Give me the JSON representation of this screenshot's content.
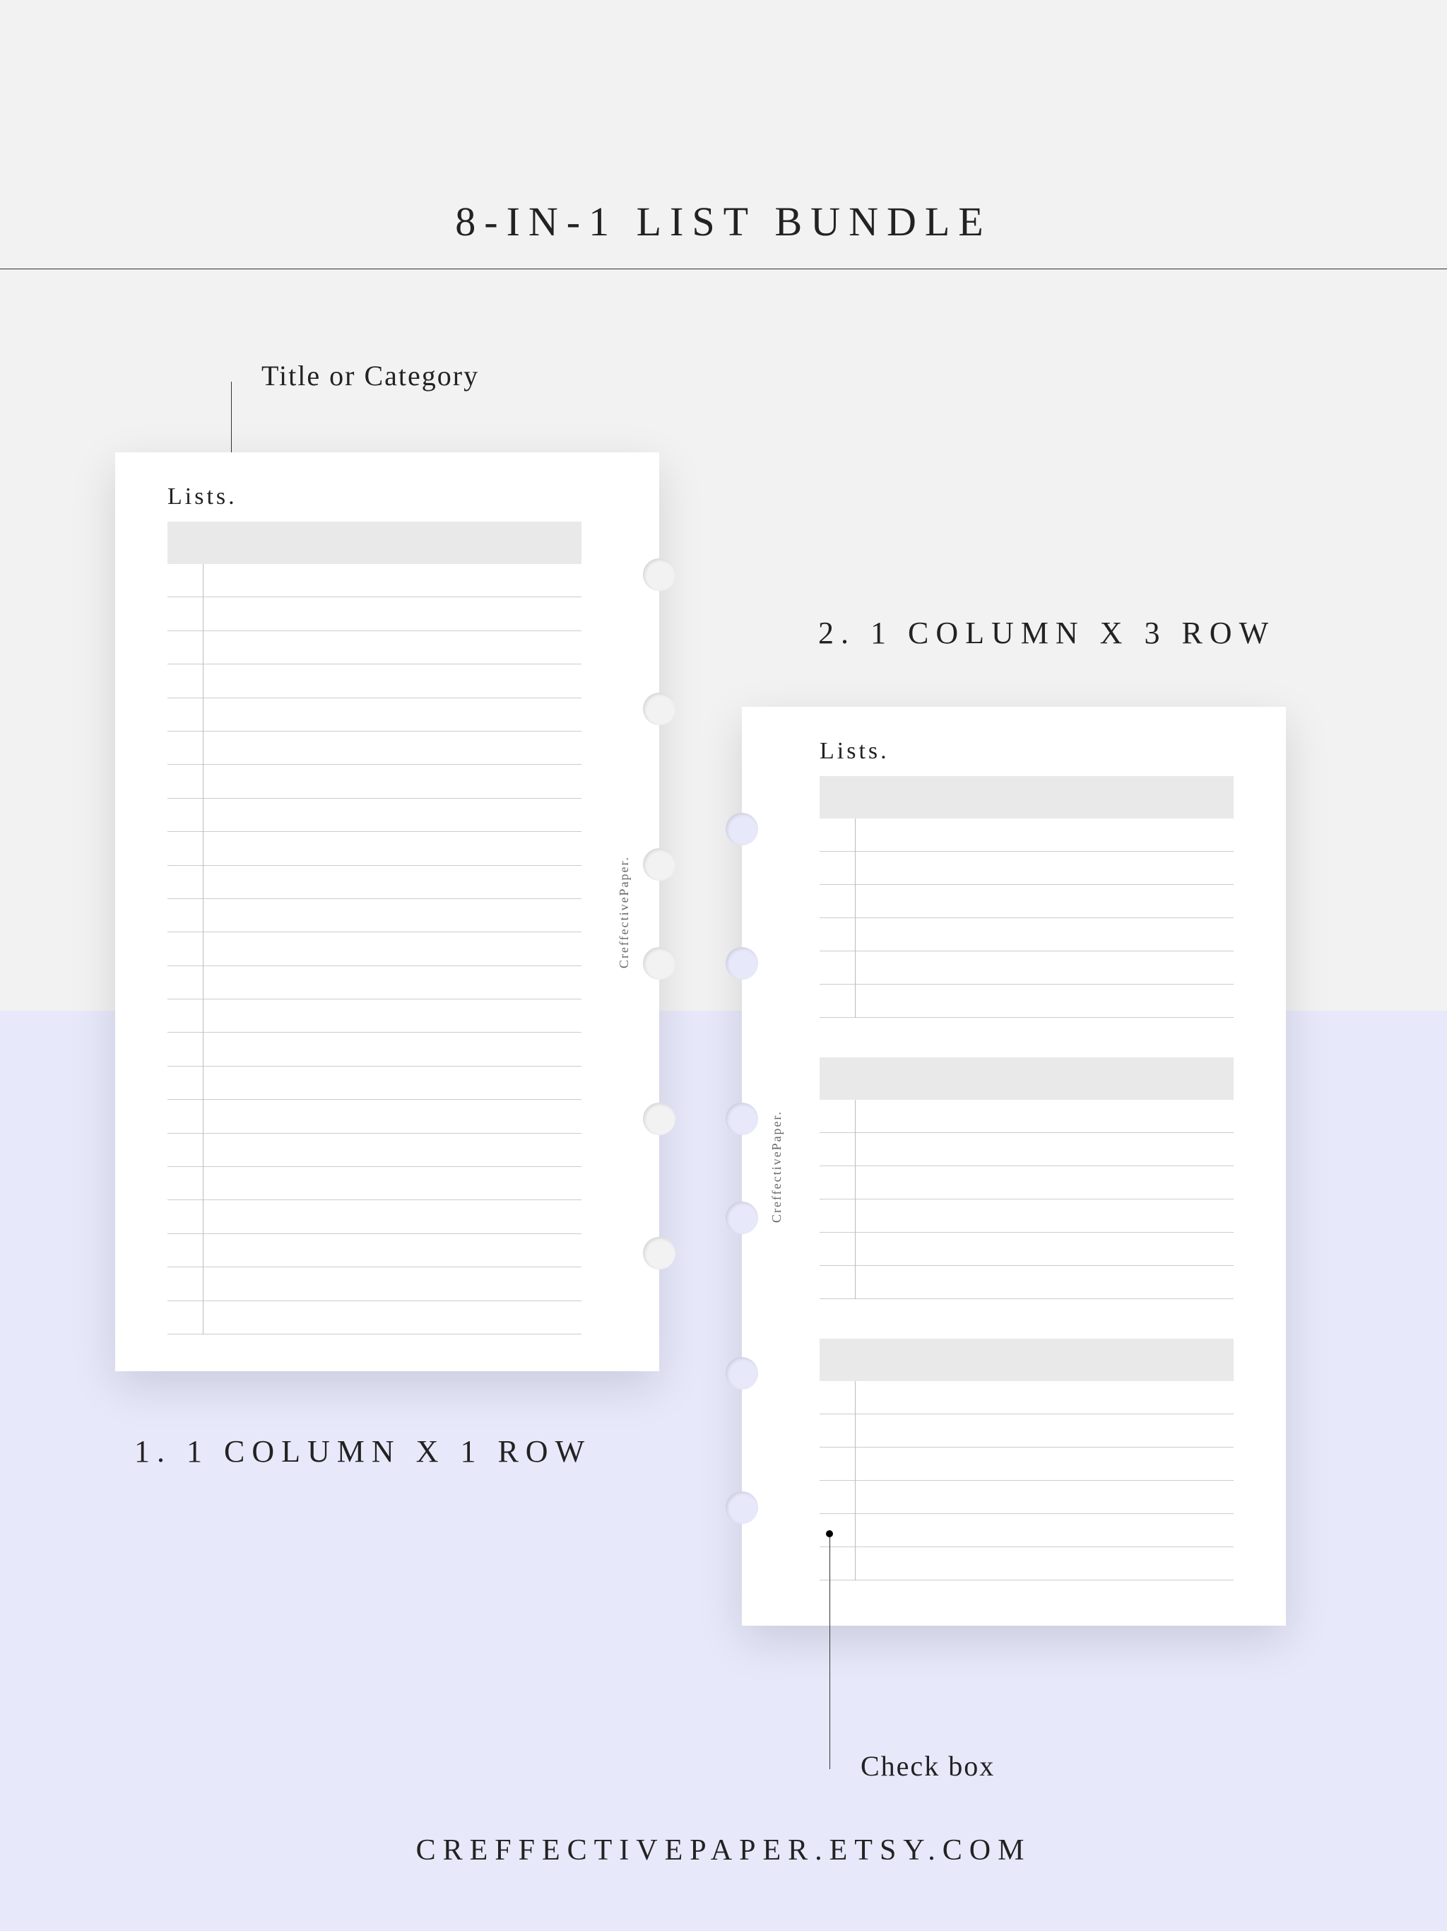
{
  "title": "8-IN-1 LIST BUNDLE",
  "callouts": {
    "title": "Title or Category",
    "checkbox": "Check box"
  },
  "cards": {
    "card1": {
      "label": "1. 1 COLUMN X 1 ROW",
      "header": "Lists.",
      "lines": 23
    },
    "card2": {
      "label": "2. 1 COLUMN X 3 ROW",
      "header": "Lists.",
      "sections": 3,
      "lines_per_section": 6
    }
  },
  "brand": "CreffectivePaper.",
  "footer": "CREFFECTIVEPAPER.ETSY.COM",
  "colors": {
    "bg_top": "#f2f2f2",
    "bg_bottom": "#e7e9fb",
    "title_bar": "#e9e9e9",
    "line": "#cccccc"
  }
}
